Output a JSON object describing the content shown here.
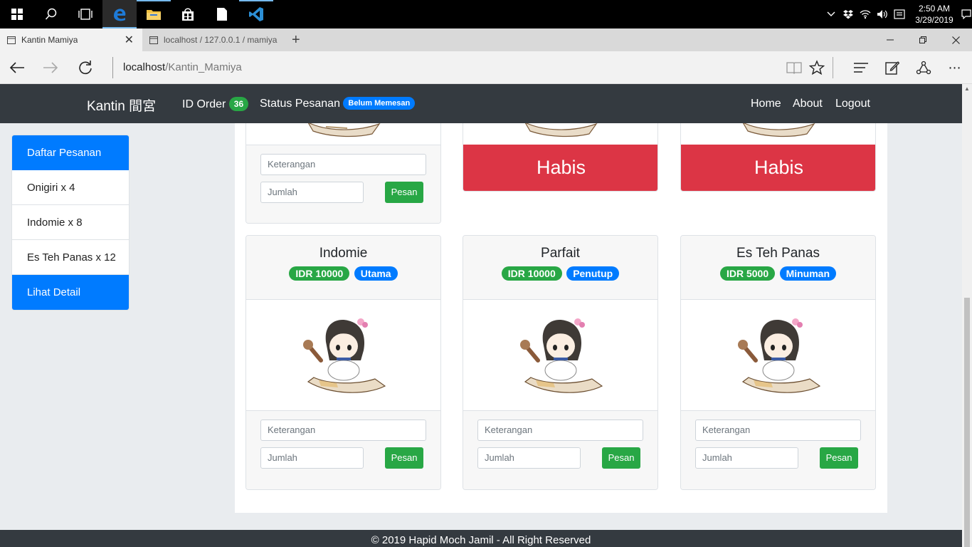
{
  "taskbar": {
    "time": "2:50 AM",
    "date": "3/29/2019"
  },
  "browser": {
    "tabs": [
      {
        "label": "Kantin Mamiya"
      },
      {
        "label": "localhost / 127.0.0.1 / mamiya"
      }
    ],
    "url_host": "localhost",
    "url_path": "/Kantin_Mamiya"
  },
  "navbar": {
    "brand": "Kantin 間宮",
    "id_order_label": "ID Order",
    "id_order_value": "36",
    "status_label": "Status Pesanan",
    "status_value": "Belum Memesan",
    "links": [
      "Home",
      "About",
      "Logout"
    ]
  },
  "sidebar": {
    "header": "Daftar Pesanan",
    "items": [
      "Onigiri x 4",
      "Indomie x 8",
      "Es Teh Panas x 12"
    ],
    "detail_button": "Lihat Detail"
  },
  "top_cards": {
    "keterangan_placeholder": "Keterangan",
    "jumlah_placeholder": "Jumlah",
    "order_label": "Pesan",
    "sold_out_label": "Habis"
  },
  "menu_cards": [
    {
      "name": "Indomie",
      "price": "IDR 10000",
      "category": "Utama",
      "keterangan_placeholder": "Keterangan",
      "jumlah_placeholder": "Jumlah",
      "order_label": "Pesan"
    },
    {
      "name": "Parfait",
      "price": "IDR 10000",
      "category": "Penutup",
      "keterangan_placeholder": "Keterangan",
      "jumlah_placeholder": "Jumlah",
      "order_label": "Pesan"
    },
    {
      "name": "Es Teh Panas",
      "price": "IDR 5000",
      "category": "Minuman",
      "keterangan_placeholder": "Keterangan",
      "jumlah_placeholder": "Jumlah",
      "order_label": "Pesan"
    }
  ],
  "footer": {
    "text": "© 2019 Hapid Moch Jamil - All Right Reserved"
  },
  "colors": {
    "navbar_bg": "#343a40",
    "primary": "#007bff",
    "success": "#28a745",
    "danger": "#dc3545"
  }
}
